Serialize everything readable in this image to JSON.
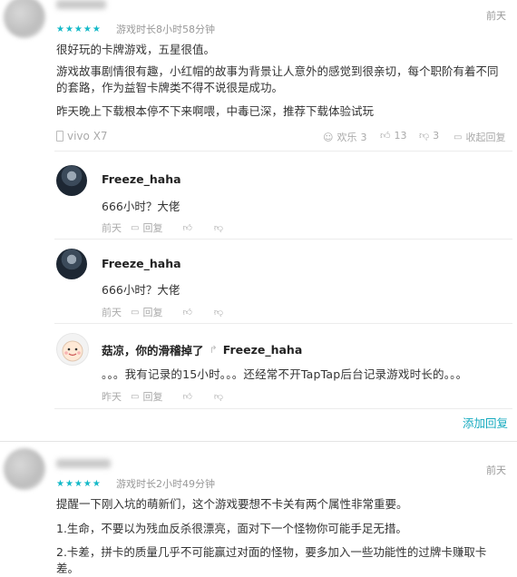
{
  "review1": {
    "playtime": "游戏时长8小时58分钟",
    "date": "前天",
    "stars": "★★★★★",
    "paragraphs": [
      "很好玩的卡牌游戏，五星很值。",
      "游戏故事剧情很有趣，小红帽的故事为背景让人意外的感觉到很亲切，每个职阶有着不同的套路，作为益智卡牌类不得不说很是成功。",
      "昨天晚上下载根本停不下来啊喂，中毒已深，推荐下载体验试玩"
    ],
    "device": "vivo X7",
    "fun_label": "欢乐",
    "fun_count": "3",
    "up_count": "13",
    "down_count": "3",
    "collapse_label": "收起回复"
  },
  "replies": [
    {
      "user": "Freeze_haha",
      "text": "666小时？大佬",
      "date": "前天",
      "reply_label": "回复"
    },
    {
      "user": "Freeze_haha",
      "text": "666小时？大佬",
      "date": "前天",
      "reply_label": "回复"
    },
    {
      "user": "菇凉，你的滑稽掉了",
      "reply_to": "Freeze_haha",
      "text": "。。。我有记录的15小时。。。还经常不开TapTap后台记录游戏时长的。。。",
      "date": "昨天",
      "reply_label": "回复"
    }
  ],
  "add_reply_label": "添加回复",
  "review2": {
    "playtime": "游戏时长2小时49分钟",
    "date": "前天",
    "stars": "★★★★★",
    "paragraphs": [
      "提醒一下刚入坑的萌新们，这个游戏要想不卡关有两个属性非常重要。",
      "1.生命，不要以为残血反杀很漂亮，面对下一个怪物你可能手足无措。",
      "2.卡差，拼卡的质量几乎不可能赢过对面的怪物，要多加入一些功能性的过牌卡赚取卡差。"
    ]
  },
  "colors": {
    "accent": "#14b9c8",
    "link": "#14aabf"
  }
}
